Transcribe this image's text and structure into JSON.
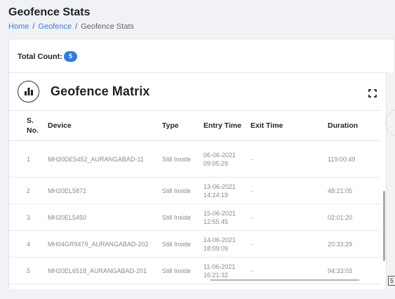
{
  "page": {
    "title": "Geofence Stats",
    "breadcrumb": {
      "home": "Home",
      "geofence": "Geofence",
      "current": "Geofence Stats"
    }
  },
  "summary": {
    "total_label": "Total Count:",
    "total_value": "5"
  },
  "matrix": {
    "title": "Geofence Matrix",
    "icons": {
      "header": "bar-chart-icon",
      "expand": "expand-icon"
    },
    "columns": [
      "S. No.",
      "Device",
      "Type",
      "Entry Time",
      "Exit Time",
      "Duration"
    ],
    "rows": [
      {
        "sno": "1",
        "device": "MH20DE5452_AURANGABAD-11",
        "type": "Still Inside",
        "entry": "06-06-2021 09:05:29",
        "exit": "-",
        "duration": "119:00:49"
      },
      {
        "sno": "2",
        "device": "MH20EL5872",
        "type": "Still Inside",
        "entry": "13-06-2021 14:24:19",
        "exit": "-",
        "duration": "48:21:05"
      },
      {
        "sno": "3",
        "device": "MH20EL5450",
        "type": "Still Inside",
        "entry": "15-06-2021 12:55:45",
        "exit": "-",
        "duration": "02:01:20"
      },
      {
        "sno": "4",
        "device": "MH04GR9479_AURANGABAD-202",
        "type": "Still Inside",
        "entry": "14-06-2021 18:09:09",
        "exit": "-",
        "duration": "20:33:29"
      },
      {
        "sno": "5",
        "device": "MH20EL6518_AURANGABAD-201",
        "type": "Still Inside",
        "entry": "11-06-2021 16:21:32",
        "exit": "-",
        "duration": "94:33:03"
      }
    ]
  },
  "edge": {
    "corner_label": "5"
  },
  "colors": {
    "accent": "#2f7bdc",
    "link": "#3f7fd6",
    "background": "#f0f2f5"
  }
}
